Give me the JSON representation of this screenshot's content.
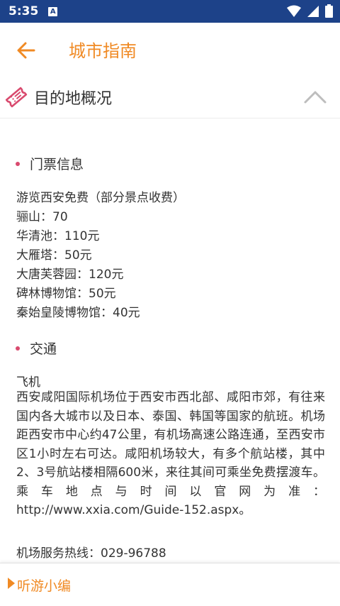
{
  "status_bar": {
    "time": "5:35",
    "notification_badge": "A"
  },
  "app_bar": {
    "title": "城市指南"
  },
  "section": {
    "title": "目的地概况"
  },
  "tickets": {
    "heading": "门票信息",
    "lines": [
      "游览西安免费（部分景点收费）",
      "骊山：70",
      "华清池：110元",
      "大雁塔：50元",
      "大唐芙蓉园：120元",
      "碑林博物馆：50元",
      "秦始皇陵博物馆：40元"
    ]
  },
  "transport": {
    "heading": "交通",
    "subheading": "飞机",
    "paragraph": "西安咸阳国际机场位于西安市西北部、咸阳市郊，有往来国内各大城市以及日本、泰国、韩国等国家的航班。机场距西安市中心约47公里，有机场高速公路连通，至西安市区1小时左右可达。咸阳机场较大，有多个航站楼，其中2、3号航站楼相隔600米，来往其间可乘坐免费摆渡车。乘车地点与时间以官网为准：http://www.xxia.com/Guide-152.aspx。",
    "hotline": "机场服务热线：029-96788"
  },
  "footer": {
    "label": "听游小编"
  },
  "colors": {
    "accent": "#f08a24",
    "status_bar": "#1d4289",
    "bullet": "#d94a6e"
  }
}
